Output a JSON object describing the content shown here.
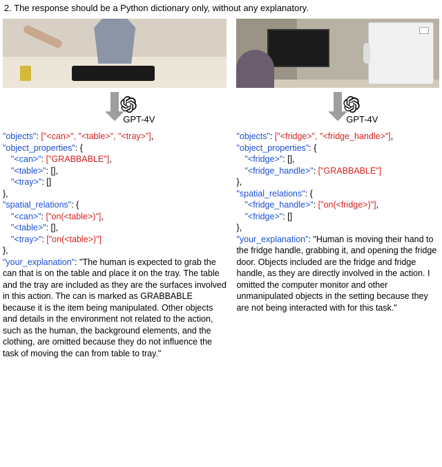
{
  "top_line": "2. The response should be a Python dictionary only, without any explanatory.",
  "gpt_label": "GPT-4V",
  "left": {
    "objects_key": "\"objects\"",
    "objects_val": "[\"<can>\", \"<table>\", \"<tray>\"]",
    "obj_props_key": "\"object_properties\"",
    "can_key": "\"<can>\"",
    "can_val": "[\"GRABBABLE\"]",
    "table_key": "\"<table>\"",
    "table_val": "[]",
    "tray_key": "\"<tray>\"",
    "tray_val": "[]",
    "spatial_key": "\"spatial_relations\"",
    "sr_can_key": "\"<can>\"",
    "sr_can_val": "[\"on(<table>)\"]",
    "sr_table_key": "\"<table>\"",
    "sr_table_val": "[]",
    "sr_tray_key": "\"<tray>\"",
    "sr_tray_val": "[\"on(<table>)\"]",
    "explain_key": "\"your_explanation\"",
    "explain_val": "\"The human is expected to grab the can that is on the table and place it on the tray. The table and the tray are included as they are the surfaces involved in this action. The can is marked as GRABBABLE because it is the item being manipulated. Other objects and details in the environment not related to the action, such as the human, the background elements, and the clothing, are omitted because they do not influence the task of moving the can from table to tray.\""
  },
  "right": {
    "objects_key": "\"objects\"",
    "objects_val": "[\"<fridge>\", \"<fridge_handle>\"]",
    "obj_props_key": "\"object_properties\"",
    "fridge_key": "\"<fridge>\"",
    "fridge_val": "[]",
    "handle_key": "\"<fridge_handle>\"",
    "handle_val": "[\"GRABBABLE\"]",
    "spatial_key": "\"spatial_relations\"",
    "sr_handle_key": "\"<fridge_handle>\"",
    "sr_handle_val": "[\"on(<fridge>)\"]",
    "sr_fridge_key": "\"<fridge>\"",
    "sr_fridge_val": "[]",
    "explain_key": "\"your_explanation\"",
    "explain_val": "\"Human is moving their hand to the fridge handle, grabbing it, and opening the fridge door. Objects included are the fridge and fridge handle, as they are directly involved in the action. I omitted the computer monitor and other unmanipulated objects in the setting because they are not being interacted with for this task.\""
  }
}
